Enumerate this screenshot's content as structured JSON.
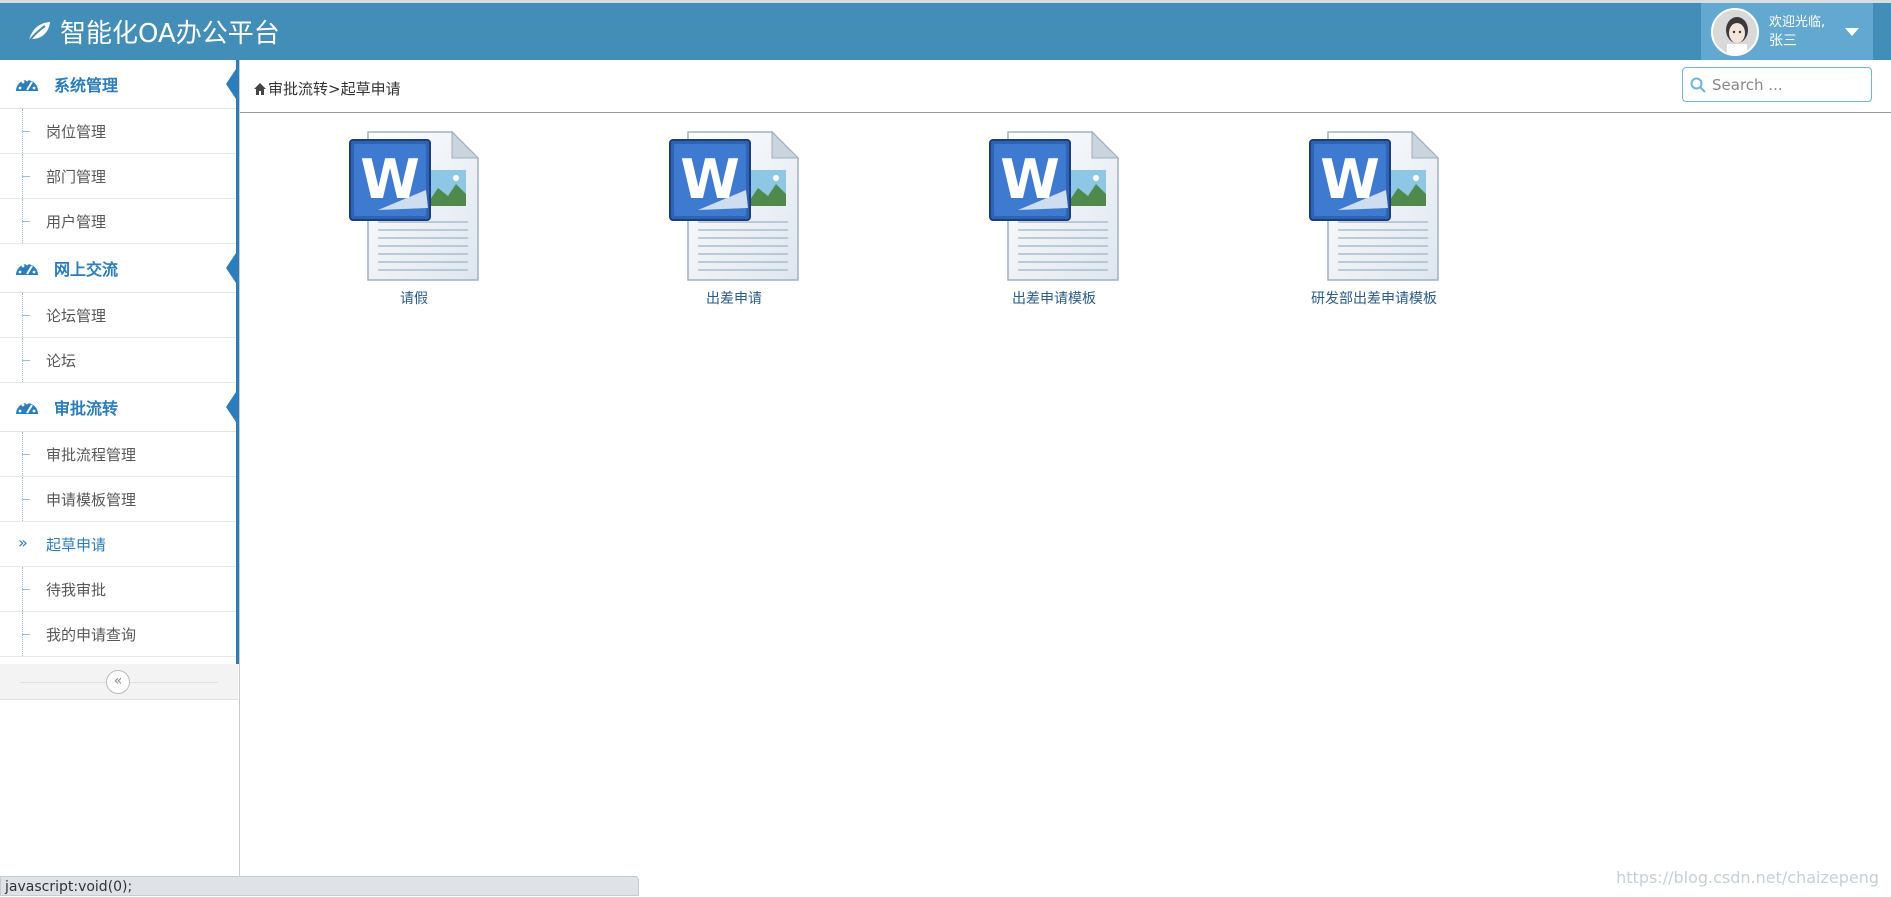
{
  "header": {
    "brand_title": "智能化OA办公平台",
    "welcome_text": "欢迎光临,",
    "user_name": "张三"
  },
  "sidebar": {
    "sections": [
      {
        "label": "系统管理",
        "items": [
          "岗位管理",
          "部门管理",
          "用户管理"
        ]
      },
      {
        "label": "网上交流",
        "items": [
          "论坛管理",
          "论坛"
        ]
      },
      {
        "label": "审批流转",
        "items": [
          "审批流程管理",
          "申请模板管理",
          "起草申请",
          "待我审批",
          "我的申请查询"
        ]
      }
    ],
    "active_item": "起草申请",
    "collapse_icon": "double-chevron-left-icon"
  },
  "breadcrumb": {
    "parent": "审批流转",
    "separator": ">",
    "current": "起草申请"
  },
  "search": {
    "placeholder": "Search ..."
  },
  "documents": [
    {
      "label": "请假",
      "icon": "word-document-icon"
    },
    {
      "label": "出差申请",
      "icon": "word-document-icon"
    },
    {
      "label": "出差申请模板",
      "icon": "word-document-icon"
    },
    {
      "label": "研发部出差申请模板",
      "icon": "word-document-icon"
    }
  ],
  "statusbar": {
    "text": "javascript:void(0);"
  },
  "watermark": "https://blog.csdn.net/chaizepeng",
  "colors": {
    "header_bg": "#438eb9",
    "user_area_bg": "#62a8d1",
    "accent": "#2b7dbc"
  }
}
